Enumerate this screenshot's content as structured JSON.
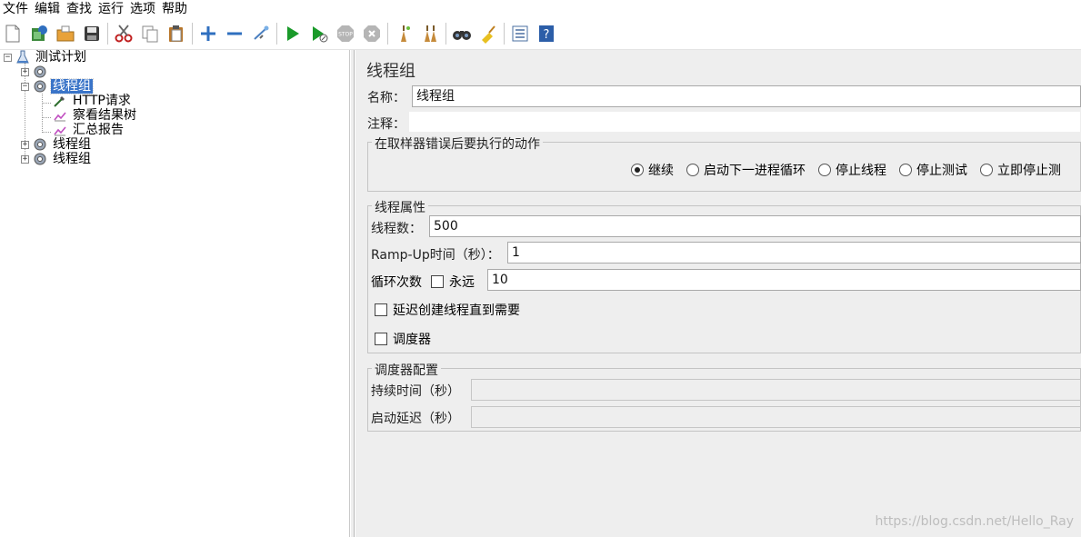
{
  "menu": [
    "文件",
    "编辑",
    "查找",
    "运行",
    "选项",
    "帮助"
  ],
  "toolbar": {
    "icons": [
      "new-icon",
      "templates-icon",
      "open-icon",
      "save-icon",
      "cut-icon",
      "copy-icon",
      "paste-icon",
      "expand-icon",
      "collapse-icon",
      "toggle-icon",
      "start-icon",
      "start-no-pause-icon",
      "stop-icon",
      "shutdown-icon",
      "clear-icon",
      "clear-all-icon",
      "search-icon",
      "reset-search-icon",
      "function-helper-icon",
      "help-icon"
    ]
  },
  "tree": {
    "root": "测试计划",
    "selected": "线程组",
    "children_http": "HTTP请求",
    "children_view": "察看结果树",
    "children_report": "汇总报告",
    "group2": "线程组",
    "group3": "线程组"
  },
  "panel": {
    "title": "线程组",
    "name_label": "名称：",
    "name_value": "线程组",
    "comment_label": "注释：",
    "comment_value": "",
    "error_action": {
      "title": "在取样器错误后要执行的动作",
      "options": [
        "继续",
        "启动下一进程循环",
        "停止线程",
        "停止测试",
        "立即停止测"
      ],
      "selected_index": 0
    },
    "thread_props": {
      "title": "线程属性",
      "threads_label": "线程数：",
      "threads_value": "500",
      "rampup_label": "Ramp-Up时间（秒）：",
      "rampup_value": "1",
      "loop_label": "循环次数",
      "forever_label": "永远",
      "forever_checked": false,
      "loop_value": "10",
      "delay_label": "延迟创建线程直到需要",
      "delay_checked": false,
      "scheduler_label": "调度器",
      "scheduler_checked": false
    },
    "scheduler": {
      "title": "调度器配置",
      "duration_label": "持续时间（秒）",
      "duration_value": "",
      "delay_label": "启动延迟（秒）",
      "delay_value": ""
    }
  },
  "watermark": "https://blog.csdn.net/Hello_Ray"
}
